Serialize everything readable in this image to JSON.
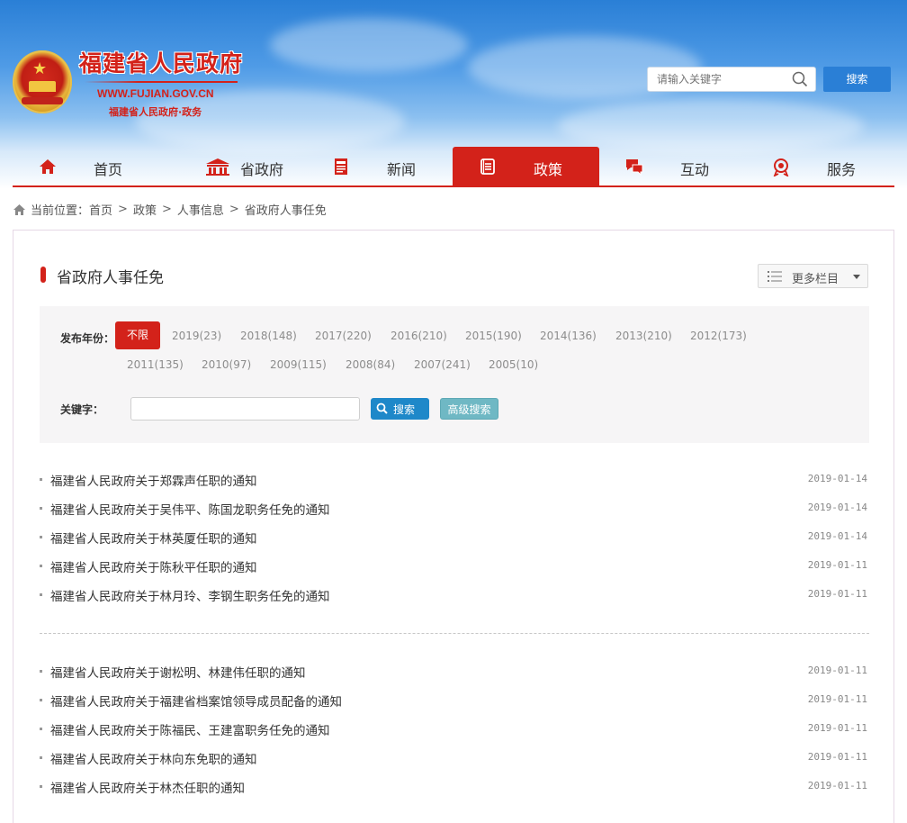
{
  "header": {
    "site_title": "福建省人民政府",
    "site_url": "WWW.FUJIAN.GOV.CN",
    "site_subtitle": "福建省人民政府·政务",
    "search_placeholder": "请输入关键字",
    "search_button": "搜索",
    "colors": {
      "brand_red": "#d3221a",
      "sky_blue": "#2a7fd6"
    }
  },
  "nav": {
    "items": [
      {
        "label": "首页",
        "icon": "home-icon",
        "active": false
      },
      {
        "label": "省政府",
        "icon": "government-building-icon",
        "active": false
      },
      {
        "label": "新闻",
        "icon": "newspaper-icon",
        "active": false
      },
      {
        "label": "政策",
        "icon": "document-icon",
        "active": true
      },
      {
        "label": "互动",
        "icon": "chat-bubbles-icon",
        "active": false
      },
      {
        "label": "服务",
        "icon": "service-icon",
        "active": false
      }
    ]
  },
  "breadcrumb": {
    "prefix": "当前位置：",
    "items": [
      "首页",
      "政策",
      "人事信息",
      "省政府人事任免"
    ],
    "separator": ">"
  },
  "section": {
    "title": "省政府人事任免",
    "more_label": "更多栏目"
  },
  "filter": {
    "year_label": "发布年份：",
    "years": [
      "不限",
      "2019(23)",
      "2018(148)",
      "2017(220)",
      "2016(210)",
      "2015(190)",
      "2014(136)",
      "2013(210)",
      "2012(173)",
      "2011(135)",
      "2010(97)",
      "2009(115)",
      "2008(84)",
      "2007(241)",
      "2005(10)"
    ],
    "active_year": "不限",
    "keyword_label": "关键字：",
    "keyword_value": "",
    "search_button": "搜索",
    "advanced_button": "高级搜索"
  },
  "articles": {
    "group1": [
      {
        "title": "福建省人民政府关于郑霖声任职的通知",
        "date": "2019-01-14"
      },
      {
        "title": "福建省人民政府关于吴伟平、陈国龙职务任免的通知",
        "date": "2019-01-14"
      },
      {
        "title": "福建省人民政府关于林英厦任职的通知",
        "date": "2019-01-14"
      },
      {
        "title": "福建省人民政府关于陈秋平任职的通知",
        "date": "2019-01-11"
      },
      {
        "title": "福建省人民政府关于林月玲、李钢生职务任免的通知",
        "date": "2019-01-11"
      }
    ],
    "group2": [
      {
        "title": "福建省人民政府关于谢松明、林建伟任职的通知",
        "date": "2019-01-11"
      },
      {
        "title": "福建省人民政府关于福建省档案馆领导成员配备的通知",
        "date": "2019-01-11"
      },
      {
        "title": "福建省人民政府关于陈福民、王建富职务任免的通知",
        "date": "2019-01-11"
      },
      {
        "title": "福建省人民政府关于林向东免职的通知",
        "date": "2019-01-11"
      },
      {
        "title": "福建省人民政府关于林杰任职的通知",
        "date": "2019-01-11"
      }
    ]
  }
}
